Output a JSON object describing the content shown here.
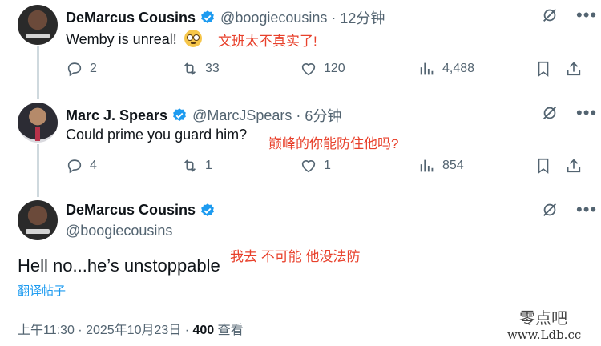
{
  "tweet1": {
    "name": "DeMarcus Cousins",
    "handle": "@boogiecousins",
    "separator": "·",
    "time": "12分钟",
    "text": "Wemby is unreal!",
    "annotation": "文班太不真实了!",
    "replies": "2",
    "retweets": "33",
    "likes": "120",
    "views": "4,488"
  },
  "tweet2": {
    "name": "Marc J. Spears",
    "handle": "@MarcJSpears",
    "separator": "·",
    "time": "6分钟",
    "text": "Could prime you guard him?",
    "annotation": "巅峰的你能防住他吗?",
    "replies": "4",
    "retweets": "1",
    "likes": "1",
    "views": "854"
  },
  "main": {
    "name": "DeMarcus Cousins",
    "handle": "@boogiecousins",
    "text": "Hell no...he’s unstoppable",
    "annotation": "我去 不可能 他没法防",
    "translate": "翻译帖子",
    "timestamp": "上午11:30 · 2025年10月23日 · ",
    "views_count": "400",
    "views_label": " 查看"
  },
  "watermark": {
    "line1": "零点吧",
    "line2": "www.Ldb.cc"
  },
  "colors": {
    "accent": "#1d9bf0",
    "annotation": "#e8412c",
    "muted": "#536471"
  },
  "icons": [
    "verified-badge-icon",
    "grok-icon",
    "more-icon",
    "reply-icon",
    "retweet-icon",
    "like-icon",
    "views-icon",
    "bookmark-icon",
    "share-icon"
  ]
}
